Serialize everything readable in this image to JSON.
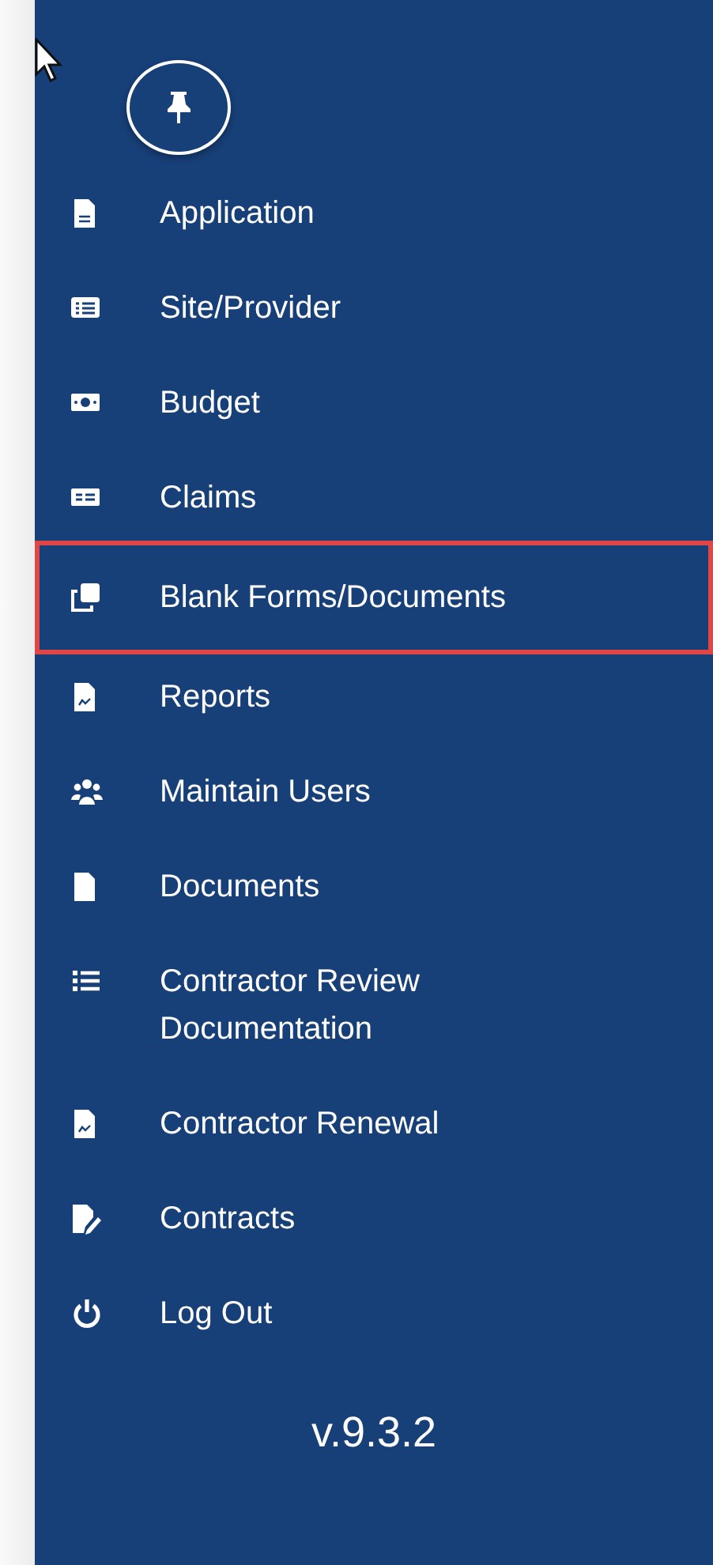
{
  "sidebar": {
    "items": [
      {
        "label": "Application",
        "highlighted": false
      },
      {
        "label": "Site/Provider",
        "highlighted": false
      },
      {
        "label": "Budget",
        "highlighted": false
      },
      {
        "label": "Claims",
        "highlighted": false
      },
      {
        "label": "Blank Forms/Documents",
        "highlighted": true
      },
      {
        "label": "Reports",
        "highlighted": false
      },
      {
        "label": "Maintain Users",
        "highlighted": false
      },
      {
        "label": "Documents",
        "highlighted": false
      },
      {
        "label": "Contractor Review Documentation",
        "highlighted": false
      },
      {
        "label": "Contractor Renewal",
        "highlighted": false
      },
      {
        "label": "Contracts",
        "highlighted": false
      },
      {
        "label": "Log Out",
        "highlighted": false
      }
    ],
    "version": "v.9.3.2"
  }
}
